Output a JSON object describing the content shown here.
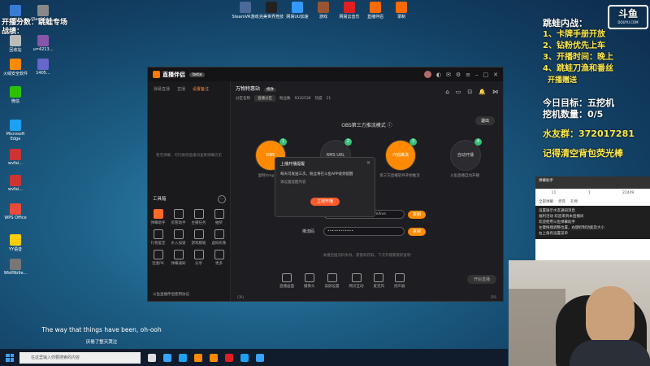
{
  "desktop": {
    "top_left_text": [
      "开播分数：跳蛙专场",
      "战绩："
    ],
    "icons_left": [
      {
        "label": "此电脑",
        "color": "#3a7bd5"
      },
      {
        "label": "f3ae94dcf...",
        "color": "#888888"
      },
      {
        "label": "回收站",
        "color": "#bbbbbb"
      },
      {
        "label": "u=4213...",
        "color": "#8855aa"
      },
      {
        "label": "火绒安全软件",
        "color": "#ff8a00"
      },
      {
        "label": "1405...",
        "color": "#6666cc"
      },
      {
        "label": "微信",
        "color": "#2dc100"
      },
      {
        "label": "Microsoft Edge",
        "color": "#1da1f2"
      },
      {
        "label": "wvfai...",
        "color": "#cc3333"
      },
      {
        "label": "wvfai...",
        "color": "#cc3333"
      },
      {
        "label": "WPS Office",
        "color": "#e94a3a"
      },
      {
        "label": "YY语音",
        "color": "#ffcc00"
      },
      {
        "label": "96df9b9e...",
        "color": "#777777"
      }
    ],
    "icons_top": [
      {
        "label": "SteamVR游戏",
        "color": "#4a6a9a"
      },
      {
        "label": "完美世界竞技",
        "color": "#222222"
      },
      {
        "label": "网易UU加速",
        "color": "#3399ff"
      },
      {
        "label": "游戏",
        "color": "#995533"
      },
      {
        "label": "网易云音乐",
        "color": "#e02020"
      },
      {
        "label": "直播伴侣",
        "color": "#ff6a00"
      },
      {
        "label": "录制",
        "color": "#ff6a00"
      }
    ]
  },
  "overlay": {
    "lines": [
      "跳蛙内战：",
      "1、卡牌手册开放",
      "2、钻粉优先上车",
      "3、开播时间：晚上",
      "4、跳蛙刀渔和番丝",
      "开播赠送",
      "今日目标：五挖机",
      "挖机数量：0/5",
      "水友群：372017281",
      "记得清空背包荧光棒"
    ],
    "douyu_logo": "斗鱼",
    "douyu_url": "DOUYU.COM"
  },
  "app": {
    "title": "直播伴侣",
    "version": "beta",
    "left_tabs": [
      "弹幕直播",
      "直播",
      "设置备注"
    ],
    "left_active_tab": 2,
    "empty_text": "暂无弹幕，可切换到直播间查看弹幕历史",
    "toolbox_title": "工具箱",
    "tools": [
      "弹幕助手",
      "房管助手",
      "主播任务",
      "抽奖",
      "礼物鉴定",
      "水入加速",
      "游戏模板",
      "虚拟形象",
      "连麦PK",
      "弹幕通知",
      "分享",
      "更多"
    ],
    "bottom_notice": "斗鱼直播伴侣使用协议",
    "room_name": "万物特惠站",
    "room_tag": "修改",
    "meta": [
      "分区名称",
      "直播分区",
      "粉丝数",
      "9332536",
      "热度",
      "11"
    ],
    "obs_title": "OBS第三方推流模式",
    "exit_label": "退出",
    "steps": [
      {
        "num": "1",
        "icon": "OBS",
        "label": "复制rtmp地址",
        "color": "#ff8a00"
      },
      {
        "num": "2",
        "icon": "RMS URL",
        "label": "",
        "color": "#2c2c30"
      },
      {
        "num": "3",
        "icon": "开始推流",
        "label": "第三方直播软件开始推流",
        "color": "#ff8a00"
      },
      {
        "num": "4",
        "icon": "自动开播",
        "label": "斗鱼直播自动开播",
        "color": "#2c2c30"
      }
    ],
    "rows": [
      {
        "label": "推流地址",
        "value": "rtmp://sendtc3a.douyu.com/live",
        "btn": "复制"
      },
      {
        "label": "推流码",
        "value": "••••••••••••",
        "btn": "复制"
      }
    ],
    "hint": "关播后推流码失效，需重新获取。下次开播需重新复制",
    "controls": [
      "直播画面",
      "摄像头",
      "美颜设置",
      "网页互动",
      "麦克风",
      "扬声器"
    ],
    "start_label": "开始直播",
    "status_left": "CPU",
    "status_right": "FPS"
  },
  "dialog": {
    "title": "上播开播提醒",
    "close": "✕",
    "body": "每天可发送三次，粉丝将在斗鱼APP收到提醒",
    "sub": "请设置提醒内容",
    "ok": "立即开播"
  },
  "chat": {
    "header": "弹幕助手",
    "stats": [
      "11",
      "1",
      "22449"
    ],
    "tabs": [
      "全部弹幕",
      "贵宾",
      "礼物"
    ],
    "messages": [
      "设置展示水友通知消息",
      "福利活动 欢迎来到本直播间",
      "欢迎使用斗鱼弹幕助手",
      "左键拖拽调整位置，右键控制功能及大小",
      "右上角有设置菜单"
    ]
  },
  "lyrics": {
    "line1": "The way that things have been, oh-ooh",
    "line2": "厌倦了整天哭泣"
  },
  "taskbar": {
    "search_placeholder": "在这里输入你要搜索的内容",
    "pinned_colors": [
      "#dddddd",
      "#3aa2ff",
      "#1da1f2",
      "#ff8a00",
      "#ff8a00",
      "#e02020",
      "#1da1f2",
      "#3aa2ff"
    ]
  }
}
